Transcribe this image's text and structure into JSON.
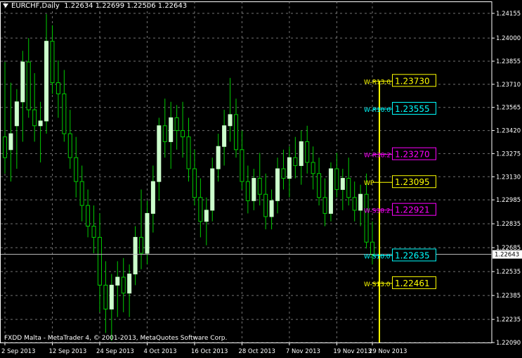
{
  "header": {
    "symbol_timeframe": "EURCHF,Daily",
    "ohlc": "1.22634 1.22699 1.22506 1.22643"
  },
  "footer_text": "FXDD Malta - MetaTrader 4, © 2001-2013, MetaQuotes Software Corp.",
  "colors": {
    "background": "#000000",
    "grid": "#c0c0c0",
    "bull_candle": "#ccffcc",
    "wick": "#00cc00",
    "yellow": "#ffff00",
    "cyan": "#00ffff",
    "magenta": "#ff00ff"
  },
  "chart_data": {
    "type": "candlestick",
    "ylim": [
      1.2209,
      1.2423
    ],
    "yticks": [
      "1.24155",
      "1.24000",
      "1.23855",
      "1.23710",
      "1.23565",
      "1.23420",
      "1.23275",
      "1.23130",
      "1.22985",
      "1.22835",
      "1.22685",
      "1.22535",
      "1.22385",
      "1.22235",
      "1.22090"
    ],
    "current_price": "1.22643",
    "xlabels": [
      "2 Sep 2013",
      "12 Sep 2013",
      "24 Sep 2013",
      "4 Oct 2013",
      "16 Oct 2013",
      "28 Oct 2013",
      "7 Nov 2013",
      "19 Nov 2013",
      "29 Nov 2013"
    ],
    "candles": [
      {
        "o": 1.2338,
        "h": 1.2385,
        "l": 1.2315,
        "c": 1.2325
      },
      {
        "o": 1.233,
        "h": 1.2372,
        "l": 1.231,
        "c": 1.234
      },
      {
        "o": 1.2345,
        "h": 1.2368,
        "l": 1.2318,
        "c": 1.236
      },
      {
        "o": 1.236,
        "h": 1.2392,
        "l": 1.2335,
        "c": 1.2385
      },
      {
        "o": 1.2385,
        "h": 1.24,
        "l": 1.235,
        "c": 1.2355
      },
      {
        "o": 1.2355,
        "h": 1.2378,
        "l": 1.2335,
        "c": 1.2345
      },
      {
        "o": 1.2345,
        "h": 1.236,
        "l": 1.2322,
        "c": 1.2348
      },
      {
        "o": 1.2348,
        "h": 1.2415,
        "l": 1.234,
        "c": 1.2398
      },
      {
        "o": 1.2398,
        "h": 1.2408,
        "l": 1.2365,
        "c": 1.2372
      },
      {
        "o": 1.2372,
        "h": 1.2386,
        "l": 1.235,
        "c": 1.2365
      },
      {
        "o": 1.2365,
        "h": 1.238,
        "l": 1.2335,
        "c": 1.234
      },
      {
        "o": 1.234,
        "h": 1.2355,
        "l": 1.2318,
        "c": 1.2325
      },
      {
        "o": 1.2325,
        "h": 1.2338,
        "l": 1.23,
        "c": 1.231
      },
      {
        "o": 1.231,
        "h": 1.232,
        "l": 1.2285,
        "c": 1.2295
      },
      {
        "o": 1.2295,
        "h": 1.2305,
        "l": 1.2275,
        "c": 1.2282
      },
      {
        "o": 1.2282,
        "h": 1.2295,
        "l": 1.2265,
        "c": 1.2275
      },
      {
        "o": 1.2275,
        "h": 1.229,
        "l": 1.2228,
        "c": 1.2245
      },
      {
        "o": 1.2245,
        "h": 1.226,
        "l": 1.2215,
        "c": 1.223
      },
      {
        "o": 1.223,
        "h": 1.2252,
        "l": 1.221,
        "c": 1.2245
      },
      {
        "o": 1.2245,
        "h": 1.226,
        "l": 1.2225,
        "c": 1.225
      },
      {
        "o": 1.225,
        "h": 1.2262,
        "l": 1.2228,
        "c": 1.224
      },
      {
        "o": 1.224,
        "h": 1.2258,
        "l": 1.2225,
        "c": 1.2252
      },
      {
        "o": 1.2252,
        "h": 1.2282,
        "l": 1.2245,
        "c": 1.2275
      },
      {
        "o": 1.2275,
        "h": 1.2305,
        "l": 1.2255,
        "c": 1.2265
      },
      {
        "o": 1.2265,
        "h": 1.2298,
        "l": 1.2258,
        "c": 1.229
      },
      {
        "o": 1.229,
        "h": 1.232,
        "l": 1.2278,
        "c": 1.231
      },
      {
        "o": 1.231,
        "h": 1.235,
        "l": 1.2298,
        "c": 1.2345
      },
      {
        "o": 1.2345,
        "h": 1.2362,
        "l": 1.2325,
        "c": 1.2335
      },
      {
        "o": 1.2335,
        "h": 1.236,
        "l": 1.2318,
        "c": 1.235
      },
      {
        "o": 1.235,
        "h": 1.2358,
        "l": 1.233,
        "c": 1.2342
      },
      {
        "o": 1.2342,
        "h": 1.236,
        "l": 1.2325,
        "c": 1.2338
      },
      {
        "o": 1.2338,
        "h": 1.235,
        "l": 1.231,
        "c": 1.2318
      },
      {
        "o": 1.2318,
        "h": 1.233,
        "l": 1.2295,
        "c": 1.23
      },
      {
        "o": 1.23,
        "h": 1.2312,
        "l": 1.2275,
        "c": 1.2285
      },
      {
        "o": 1.2285,
        "h": 1.23,
        "l": 1.227,
        "c": 1.2292
      },
      {
        "o": 1.2292,
        "h": 1.2325,
        "l": 1.2285,
        "c": 1.2318
      },
      {
        "o": 1.2318,
        "h": 1.234,
        "l": 1.231,
        "c": 1.2332
      },
      {
        "o": 1.2332,
        "h": 1.2355,
        "l": 1.232,
        "c": 1.2345
      },
      {
        "o": 1.2345,
        "h": 1.2375,
        "l": 1.2335,
        "c": 1.2352
      },
      {
        "o": 1.2352,
        "h": 1.2362,
        "l": 1.2325,
        "c": 1.233
      },
      {
        "o": 1.233,
        "h": 1.2342,
        "l": 1.2305,
        "c": 1.231
      },
      {
        "o": 1.231,
        "h": 1.232,
        "l": 1.229,
        "c": 1.2298
      },
      {
        "o": 1.2298,
        "h": 1.2318,
        "l": 1.2292,
        "c": 1.2312
      },
      {
        "o": 1.2312,
        "h": 1.2328,
        "l": 1.2295,
        "c": 1.2302
      },
      {
        "o": 1.2302,
        "h": 1.2315,
        "l": 1.228,
        "c": 1.2288
      },
      {
        "o": 1.2288,
        "h": 1.2305,
        "l": 1.228,
        "c": 1.2298
      },
      {
        "o": 1.2298,
        "h": 1.2325,
        "l": 1.229,
        "c": 1.2318
      },
      {
        "o": 1.2318,
        "h": 1.233,
        "l": 1.2305,
        "c": 1.2312
      },
      {
        "o": 1.2312,
        "h": 1.2332,
        "l": 1.23,
        "c": 1.2325
      },
      {
        "o": 1.2325,
        "h": 1.2338,
        "l": 1.2312,
        "c": 1.232
      },
      {
        "o": 1.232,
        "h": 1.2342,
        "l": 1.2308,
        "c": 1.2335
      },
      {
        "o": 1.2335,
        "h": 1.2345,
        "l": 1.2315,
        "c": 1.2322
      },
      {
        "o": 1.2322,
        "h": 1.2332,
        "l": 1.2305,
        "c": 1.2315
      },
      {
        "o": 1.2315,
        "h": 1.2325,
        "l": 1.2295,
        "c": 1.23
      },
      {
        "o": 1.23,
        "h": 1.2312,
        "l": 1.2282,
        "c": 1.229
      },
      {
        "o": 1.229,
        "h": 1.2322,
        "l": 1.2285,
        "c": 1.2318
      },
      {
        "o": 1.2318,
        "h": 1.2328,
        "l": 1.23,
        "c": 1.2305
      },
      {
        "o": 1.2305,
        "h": 1.2318,
        "l": 1.2292,
        "c": 1.2312
      },
      {
        "o": 1.2312,
        "h": 1.2325,
        "l": 1.2295,
        "c": 1.23
      },
      {
        "o": 1.23,
        "h": 1.231,
        "l": 1.2285,
        "c": 1.2292
      },
      {
        "o": 1.2292,
        "h": 1.2308,
        "l": 1.2282,
        "c": 1.2302
      },
      {
        "o": 1.2302,
        "h": 1.2315,
        "l": 1.2268,
        "c": 1.2272
      },
      {
        "o": 1.2272,
        "h": 1.2285,
        "l": 1.2258,
        "c": 1.2264
      }
    ],
    "levels": [
      {
        "label": "W-R13.0",
        "value": "1.23730",
        "v": 1.2373,
        "color": "#ffff00"
      },
      {
        "label": "W-R10.0",
        "value": "1.23555",
        "v": 1.23555,
        "color": "#00ffff"
      },
      {
        "label": "W-R38.2",
        "value": "1.23270",
        "v": 1.2327,
        "color": "#ff00ff"
      },
      {
        "label": "WP",
        "value": "1.23095",
        "v": 1.23095,
        "color": "#ffff00"
      },
      {
        "label": "W-S38.2",
        "value": "1.22921",
        "v": 1.22921,
        "color": "#ff00ff"
      },
      {
        "label": "W-S10.0",
        "value": "1.22635",
        "v": 1.22635,
        "color": "#00ffff"
      },
      {
        "label": "W-S13.0",
        "value": "1.22461",
        "v": 1.22461,
        "color": "#ffff00"
      }
    ]
  }
}
